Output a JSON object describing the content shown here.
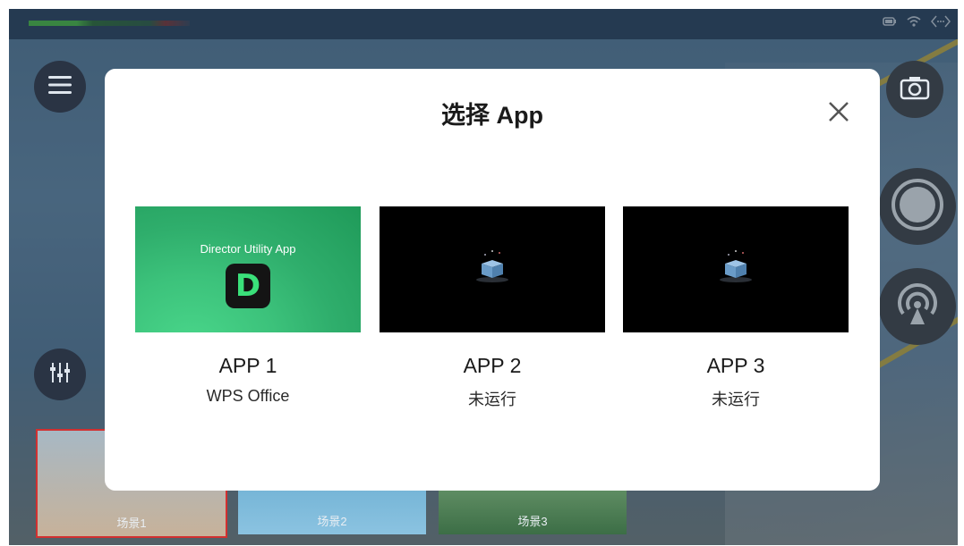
{
  "dialog": {
    "title": "选择 App",
    "close_icon": "close-icon",
    "apps": [
      {
        "name": "APP 1",
        "status": "WPS Office",
        "thumbnail_title": "Director Utility App",
        "logo_letter": "D"
      },
      {
        "name": "APP 2",
        "status": "未运行"
      },
      {
        "name": "APP 3",
        "status": "未运行"
      }
    ]
  },
  "scenes": [
    {
      "label": "场景1"
    },
    {
      "label": "场景2"
    },
    {
      "label": "场景3"
    }
  ],
  "icons": {
    "menu": "menu-icon",
    "mixer": "mixer-icon",
    "camera": "camera-icon",
    "record": "record-icon",
    "live": "live-stream-icon",
    "wifi": "wifi-icon",
    "battery": "battery-icon"
  },
  "colors": {
    "accent_green": "#3ae07a",
    "selected_scene_border": "#d23030",
    "dialog_bg": "#ffffff"
  }
}
